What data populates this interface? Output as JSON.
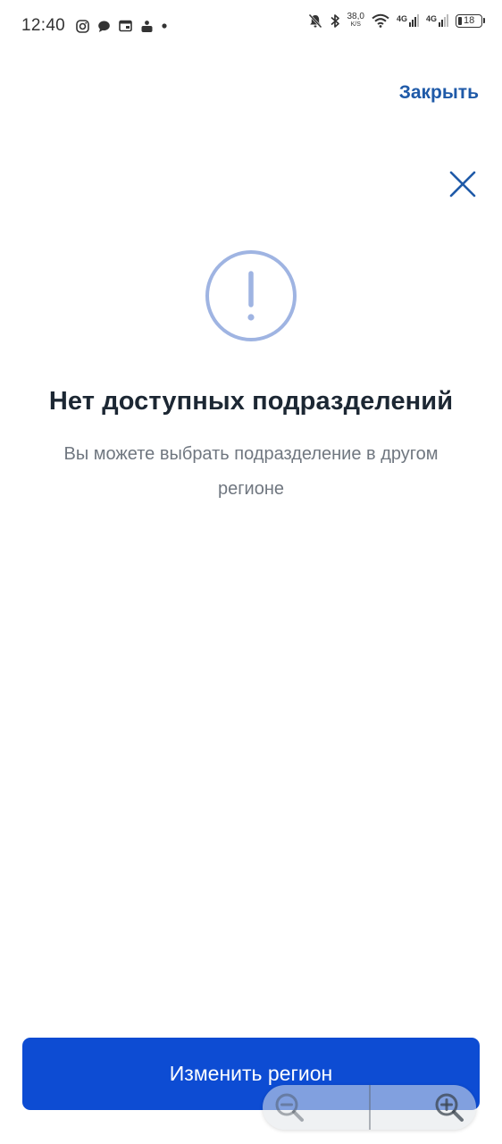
{
  "status_bar": {
    "time": "12:40",
    "left_icons": [
      "instagram-icon",
      "chat-icon",
      "calendar-icon",
      "game-icon",
      "dot-icon"
    ],
    "speed_value": "38,0",
    "speed_unit": "K/S",
    "network_1": "4G",
    "network_2": "4G",
    "battery_level": "18"
  },
  "header": {
    "close_label": "Закрыть"
  },
  "empty_state": {
    "icon": "warning-icon",
    "title": "Нет доступных подразделений",
    "description": "Вы можете выбрать подразделение в другом регионе"
  },
  "footer": {
    "primary_button_label": "Изменить регион"
  },
  "zoom_controls": {
    "zoom_out_icon": "zoom-out-icon",
    "zoom_in_icon": "zoom-in-icon"
  },
  "colors": {
    "accent": "#0d4cd3",
    "link": "#1f5aa8",
    "warning_icon": "#9fb4e2",
    "title": "#1c2733",
    "subtitle": "#707780"
  }
}
